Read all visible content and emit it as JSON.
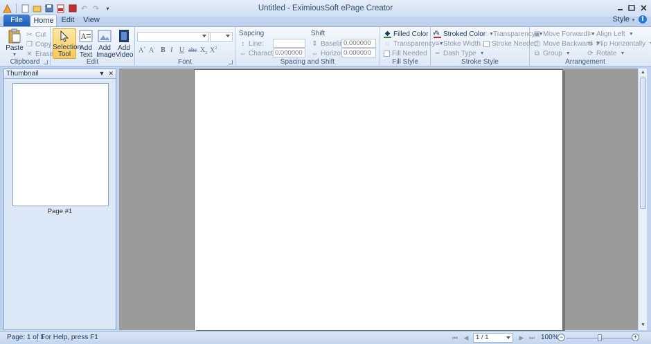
{
  "window": {
    "title": "Untitled - EximiousSoft ePage Creator"
  },
  "tabs": {
    "file": "File",
    "home": "Home",
    "edit": "Edit",
    "view": "View",
    "style_menu": "Style",
    "active": "Home"
  },
  "ribbon": {
    "clipboard": {
      "label": "Clipboard",
      "paste": "Paste",
      "cut": "Cut",
      "copy": "Copy",
      "erase": "Erase"
    },
    "edit": {
      "label": "Edit",
      "selection": "Selection Tool",
      "add_text": "Add Text",
      "add_image": "Add Image",
      "add_video": "Add Video"
    },
    "font": {
      "label": "Font",
      "family": "",
      "size": ""
    },
    "spacing": {
      "label": "Spacing and Shift",
      "spacing_title": "Sapcing",
      "line": "Line:",
      "line_value": "",
      "character": "Character:",
      "character_value": "0.000000",
      "shift_title": "Shift",
      "baseline": "Baseline:",
      "baseline_value": "0.000000",
      "horizon": "Horizon:",
      "horizon_value": "0.000000"
    },
    "fill": {
      "label": "Fill Style",
      "filled_color": "Filled Color",
      "transparency": "Transparency",
      "fill_needed": "Fill Needed"
    },
    "stroke": {
      "label": "Stroke Style",
      "stroked_color": "Stroked Color",
      "transparency": "Transparency",
      "stroke_width": "Stoke Width",
      "stroke_needed": "Stroke Needed",
      "dash_type": "Dash Type"
    },
    "arrangement": {
      "label": "Arrangement",
      "move_forward": "Move Forward",
      "align_left": "Align Left",
      "move_backward": "Move Backward",
      "flip_horizontally": "Flip Horizontally",
      "group": "Group",
      "rotate": "Rotate"
    }
  },
  "thumbnail": {
    "title": "Thumbnail",
    "page_label": "Page #1"
  },
  "status": {
    "page": "Page: 1 of 1",
    "help": "For Help, press F1",
    "page_box": "1 / 1",
    "zoom": "100%"
  },
  "zoom_fraction": 0.5
}
